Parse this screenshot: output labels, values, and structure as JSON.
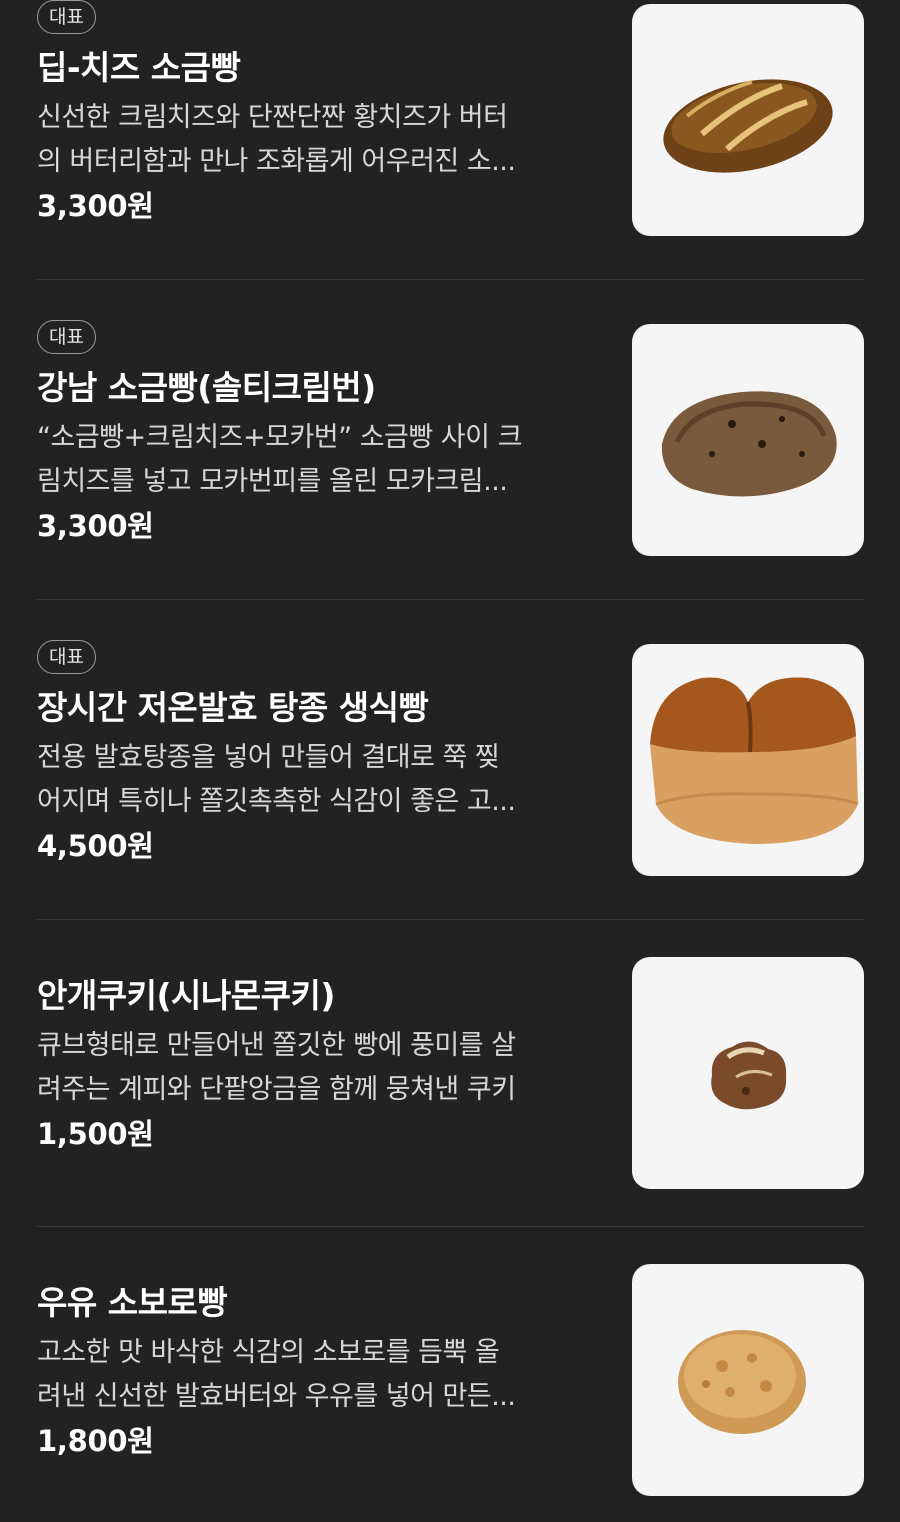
{
  "items": [
    {
      "badge": "대표",
      "name": "딥-치즈 소금빵",
      "desc_line1": "신선한 크림치즈와 단짠단짠 황치즈가 버터",
      "desc_line2": "의 버터리함과 만나 조화롭게 어우러진 소...",
      "price": "3,300원"
    },
    {
      "badge": "대표",
      "name": "강남 소금빵(솔티크림번)",
      "desc_line1": "“소금빵+크림치즈+모카번” 소금빵 사이 크",
      "desc_line2": "림치즈를 넣고 모카번피를 올린 모카크림...",
      "price": "3,300원"
    },
    {
      "badge": "대표",
      "name": "장시간 저온발효 탕종 생식빵",
      "desc_line1": "전용 발효탕종을 넣어 만들어 결대로 쭉 찢",
      "desc_line2": "어지며 특히나 쫄깃촉촉한 식감이 좋은 고...",
      "price": "4,500원"
    },
    {
      "name": "안개쿠키(시나몬쿠키)",
      "desc_line1": "큐브형태로 만들어낸 쫄깃한 빵에 풍미를 살",
      "desc_line2": "려주는 계피와 단팥앙금을 함께 뭉쳐낸 쿠키",
      "price": "1,500원"
    },
    {
      "name": "우유 소보로빵",
      "desc_line1": "고소한 맛 바삭한 식감의 소보로를 듬뿍 올",
      "desc_line2": "려낸 신선한 발효버터와 우유를 넣어 만든...",
      "price": "1,800원"
    }
  ],
  "colors": {
    "background": "#222222",
    "text": "#ffffff",
    "description": "#d7d7d7",
    "badge_border": "#9a9a9a",
    "thumbnail_bg": "#f5f5f5",
    "divider": "#3a3a3a"
  }
}
